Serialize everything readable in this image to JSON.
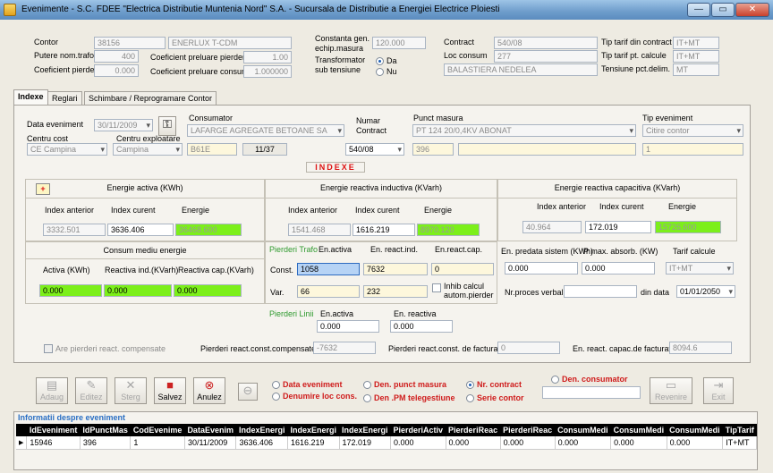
{
  "window": {
    "title": "Evenimente - S.C. FDEE \"Electrica Distributie Muntenia Nord\" S.A. - Sucursala de Distributie a Energiei Electrice Ploiesti",
    "min": "—",
    "max": "▭",
    "close": "✕"
  },
  "header": {
    "contor_label": "Contor",
    "contor_value": "38156",
    "contor_type": "ENERLUX T-CDM",
    "putere_label": "Putere nom.trafo",
    "putere_value": "400",
    "coef_pierderi_label": "Coeficient pierderi",
    "coef_pierderi_value": "0.000",
    "coef_preluare_pierderi_label": "Coeficient preluare pierderi",
    "coef_preluare_pierderi_value": "1.00",
    "coef_preluare_consum_label": "Coeficient preluare consum",
    "coef_preluare_consum_value": "1.000000",
    "constanta_label": "Constanta gen. echip.masura",
    "constanta_value": "120.000",
    "transformator_label": "Transformator sub tensiune",
    "da": "Da",
    "nu": "Nu",
    "contract_label": "Contract",
    "contract_value": "540/08",
    "loc_consum_label": "Loc consum",
    "loc_consum_value": "277",
    "loc_consum_name": "BALASTIERA NEDELEA",
    "tip_tarif_contract_label": "Tip tarif din contract",
    "tip_tarif_contract_value": "IT+MT",
    "tip_tarif_calcule_label": "Tip tarif pt. calcule",
    "tip_tarif_calcule_value": "IT+MT",
    "tensiune_label": "Tensiune pct.delim.",
    "tensiune_value": "MT"
  },
  "tabs": [
    "Indexe",
    "Reglari",
    "Schimbare / Reprogramare Contor"
  ],
  "event": {
    "data_label": "Data eveniment",
    "data_value": "30/11/2009",
    "consumator_label": "Consumator",
    "consumator_value": "LAFARGE AGREGATE BETOANE SA",
    "numar_contract_label": "Numar Contract",
    "numar_contract_value": "540/08",
    "punct_label": "Punct masura",
    "punct_value": "PT 124 20/0,4KV ABONAT",
    "tip_label": "Tip eveniment",
    "tip_value": "Citire contor",
    "centru_cost_label": "Centru cost",
    "centru_cost_value": "CE Campina",
    "centru_expl_label": "Centru exploatare",
    "centru_expl_value": "Campina",
    "code_value": "B61E",
    "counter_value": "11/37",
    "punct_nr_value": "396",
    "tip_nr_value": "1"
  },
  "indexe_title": "INDEXE",
  "activa": {
    "title": "Energie activa (KWh)",
    "col1": "Index anterior",
    "col2": "Index curent",
    "col3": "Energie",
    "anterior": "3332.501",
    "curent": "3636.406",
    "energie": "36468.600",
    "plus": "+"
  },
  "inductiva": {
    "title": "Energie reactiva inductiva (KVarh)",
    "col1": "Index anterior",
    "col2": "Index curent",
    "col3": "Energie",
    "anterior": "1541.468",
    "curent": "1616.219",
    "energie": "8970.120"
  },
  "capacitiva": {
    "title": "Energie reactiva capacitiva (KVarh)",
    "col1": "Index anterior",
    "col2": "Index curent",
    "col3": "Energie",
    "anterior": "40.964",
    "curent": "172.019",
    "energie": "15726.600"
  },
  "consum": {
    "title": "Consum mediu energie",
    "c1": "Activa (KWh)",
    "c2": "Reactiva ind.(KVarh)",
    "c3": "Reactiva cap.(KVarh)",
    "v1": "0.000",
    "v2": "0.000",
    "v3": "0.000"
  },
  "pierderi_trafo": {
    "label": "Pierderi Trafo",
    "h1": "En.activa",
    "h2": "En. react.ind.",
    "h3": "En.react.cap.",
    "const_label": "Const.",
    "var_label": "Var.",
    "const_activa": "1058",
    "const_ind": "7632",
    "const_cap": "0",
    "var_activa": "66",
    "var_ind": "232",
    "inhib": "Inhib calcul autom.pierder"
  },
  "pierderi_linii": {
    "label": "Pierderi Linii",
    "h1": "En.activa",
    "h2": "En. reactiva",
    "activa": "0.000",
    "reactiva": "0.000"
  },
  "right": {
    "predata_label": "En. predata sistem (KWh)",
    "predata_value": "0.000",
    "pmax_label": "P max. absorb. (KW)",
    "pmax_value": "0.000",
    "tarif_label": "Tarif calcule",
    "tarif_value": "IT+MT",
    "proces_label": "Nr.proces verbal",
    "proces_value": "",
    "din_data_label": "din data",
    "din_data_value": "01/01/2050"
  },
  "bottom": {
    "compensate_label": "Are pierderi react. compensate",
    "pierderi_const_label": "Pierderi react.const.compensate",
    "pierderi_const_value": "-7632",
    "facturat_label": "Pierderi react.const. de facturat",
    "facturat_value": "0",
    "capac_label": "En. react. capac.de  facturat",
    "capac_value": "8094.6"
  },
  "toolbar": {
    "adaug": "Adaug",
    "editez": "Editez",
    "sterg": "Sterg",
    "salvez": "Salvez",
    "anulez": "Anulez",
    "revenire": "Revenire",
    "exit": "Exit"
  },
  "sort": {
    "data_eveniment": "Data eveniment",
    "denumire": "Denumire  loc cons.",
    "den_punct": "Den. punct masura",
    "den_pm": "Den .PM telegestiune",
    "nr_contract": "Nr. contract",
    "serie": "Serie contor",
    "den_consumator": "Den. consumator"
  },
  "info_title": "Informatii despre eveniment",
  "grid": {
    "columns": [
      "IdEveniment",
      "IdPunctMas",
      "CodEvenime",
      "DataEvenim",
      "IndexEnergi",
      "IndexEnergi",
      "IndexEnergi",
      "PierderiActiv",
      "PierderiReac",
      "PierderiReac",
      "ConsumMedi",
      "ConsumMedi",
      "ConsumMedi",
      "TipTarif"
    ],
    "row": [
      "15946",
      "396",
      "1",
      "30/11/2009",
      "3636.406",
      "1616.219",
      "172.019",
      "0.000",
      "0.000",
      "0.000",
      "0.000",
      "0.000",
      "0.000",
      "IT+MT"
    ]
  },
  "icons": {
    "app": "app-icon",
    "key": "key-icon",
    "add": "add-icon",
    "edit": "edit-icon",
    "delete": "delete-icon",
    "save": "save-icon",
    "cancel": "cancel-icon",
    "back": "back-icon",
    "exit": "exit-icon"
  }
}
